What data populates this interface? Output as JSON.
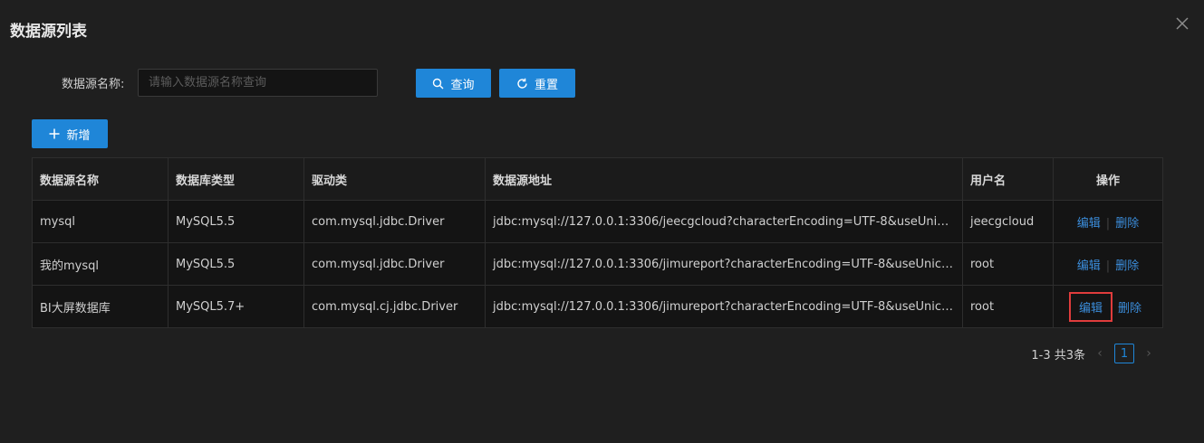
{
  "dialog": {
    "title": "数据源列表"
  },
  "filter": {
    "label": "数据源名称:",
    "placeholder": "请输入数据源名称查询",
    "value": ""
  },
  "buttons": {
    "search": "查询",
    "reset": "重置",
    "add": "新增"
  },
  "table": {
    "columns": [
      "数据源名称",
      "数据库类型",
      "驱动类",
      "数据源地址",
      "用户名",
      "操作"
    ],
    "rows": [
      {
        "name": "mysql",
        "db_type": "MySQL5.5",
        "driver": "com.mysql.jdbc.Driver",
        "url": "jdbc:mysql://127.0.0.1:3306/jeecgcloud?characterEncoding=UTF-8&useUnicode...",
        "user": "jeecgcloud",
        "edit": "编辑",
        "delete": "删除"
      },
      {
        "name": "我的mysql",
        "db_type": "MySQL5.5",
        "driver": "com.mysql.jdbc.Driver",
        "url": "jdbc:mysql://127.0.0.1:3306/jimureport?characterEncoding=UTF-8&useUnicode=...",
        "user": "root",
        "edit": "编辑",
        "delete": "删除"
      },
      {
        "name": "BI大屏数据库",
        "db_type": "MySQL5.7+",
        "driver": "com.mysql.cj.jdbc.Driver",
        "url": "jdbc:mysql://127.0.0.1:3306/jimureport?characterEncoding=UTF-8&useUnicode=...",
        "user": "root",
        "edit": "编辑",
        "delete": "删除"
      }
    ]
  },
  "pagination": {
    "summary": "1-3 共3条",
    "current_page": "1"
  },
  "colors": {
    "primary": "#1f86d8",
    "link": "#3b8ddb",
    "highlight_border": "#e03c3c",
    "background": "#1f1f1f"
  }
}
